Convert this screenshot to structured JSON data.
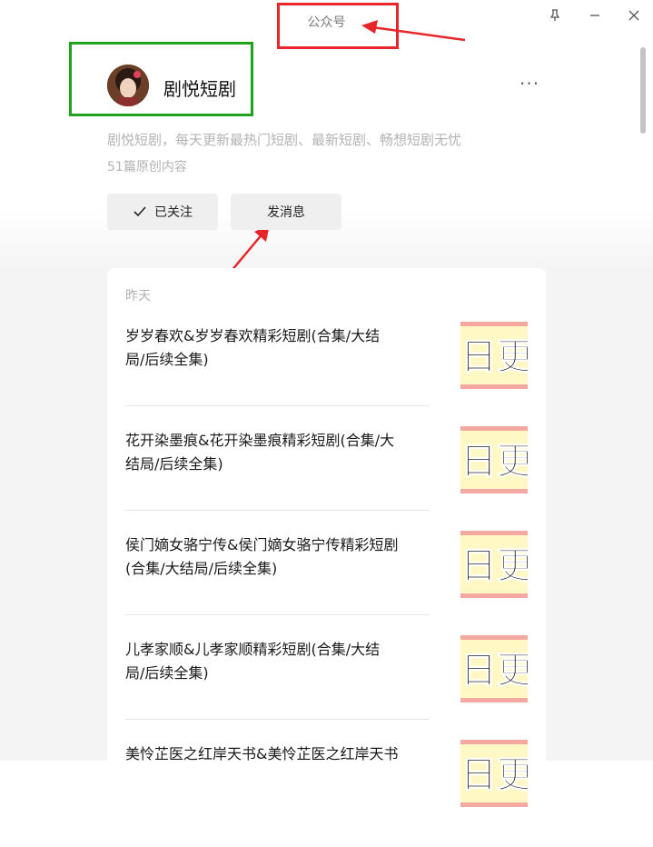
{
  "window": {
    "title": "公众号",
    "controls": [
      "pin-icon",
      "minimize-icon",
      "close-icon"
    ]
  },
  "account": {
    "name": "剧悦短剧",
    "description": "剧悦短剧，每天更新最热门短剧、最新短剧、畅想短剧无忧",
    "article_count": "51篇原创内容",
    "follow_label": "已关注",
    "message_label": "发消息",
    "more_label": "···"
  },
  "feed": {
    "date_label": "昨天",
    "items": [
      {
        "title_line1": "岁岁春欢&岁岁春欢精彩短剧(合集/大结",
        "title_line2": "局/后续全集)",
        "thumb_text": "日更"
      },
      {
        "title_line1": "花开染墨痕&花开染墨痕精彩短剧(合集/大",
        "title_line2": "结局/后续全集)",
        "thumb_text": "日更"
      },
      {
        "title_line1": "侯门嫡女骆宁传&侯门嫡女骆宁传精彩短剧",
        "title_line2": "(合集/大结局/后续全集)",
        "thumb_text": "日更"
      },
      {
        "title_line1": "儿孝家顺&儿孝家顺精彩短剧(合集/大结",
        "title_line2": "局/后续全集)",
        "thumb_text": "日更"
      },
      {
        "title_line1": "美怜芷医之红岸天书&美怜芷医之红岸天书",
        "title_line2": "",
        "thumb_text": "日更"
      }
    ]
  },
  "colors": {
    "annotation_red": "#e8262a",
    "annotation_green": "#1fa31f",
    "thumb_yellow": "#fff8c4",
    "thumb_pink": "#f4a9a0"
  }
}
